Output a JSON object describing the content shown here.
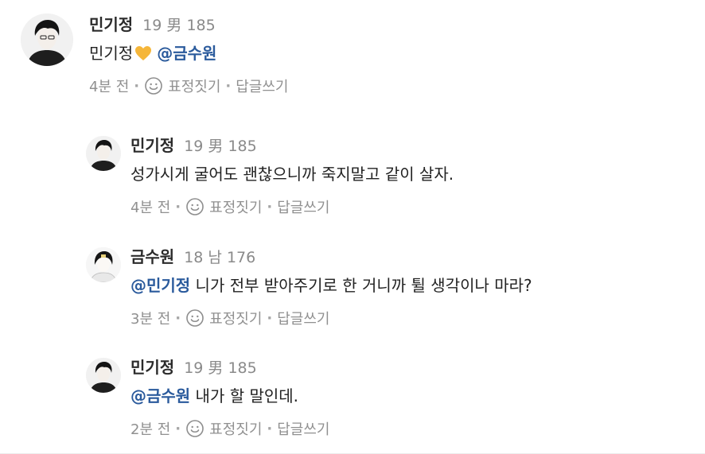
{
  "comments": [
    {
      "author": "민기정",
      "user_info": "19 男 185",
      "mention_before": "",
      "text": "민기정",
      "has_heart": true,
      "mention_after": "@금수원",
      "time": "4분 전",
      "react_label": "표정짓기",
      "reply_label": "답글쓰기",
      "avatar_icon": "avatar-dark-hair-man-icon"
    },
    {
      "author": "민기정",
      "user_info": "19 男 185",
      "text": "성가시게 굴어도 괜찮으니까 죽지말고 같이 살자.",
      "time": "4분 전",
      "react_label": "표정짓기",
      "reply_label": "답글쓰기",
      "avatar_icon": "avatar-dark-hair-man-icon"
    },
    {
      "author": "금수원",
      "user_info": "18 남 176",
      "mention": "@민기정",
      "text": " 니가 전부 받아주기로 한 거니까 튈 생각이나 마라?",
      "time": "3분 전",
      "react_label": "표정짓기",
      "reply_label": "답글쓰기",
      "avatar_icon": "avatar-pale-boy-icon"
    },
    {
      "author": "민기정",
      "user_info": "19 男 185",
      "mention": "@금수원",
      "text": " 내가 할 말인데.",
      "time": "2분 전",
      "react_label": "표정짓기",
      "reply_label": "답글쓰기",
      "avatar_icon": "avatar-dark-hair-man-icon"
    }
  ],
  "separator": "·",
  "colors": {
    "mention": "#2a5a9c",
    "heart": "#f5b63a",
    "meta": "#8a8a8a",
    "text": "#222222"
  }
}
